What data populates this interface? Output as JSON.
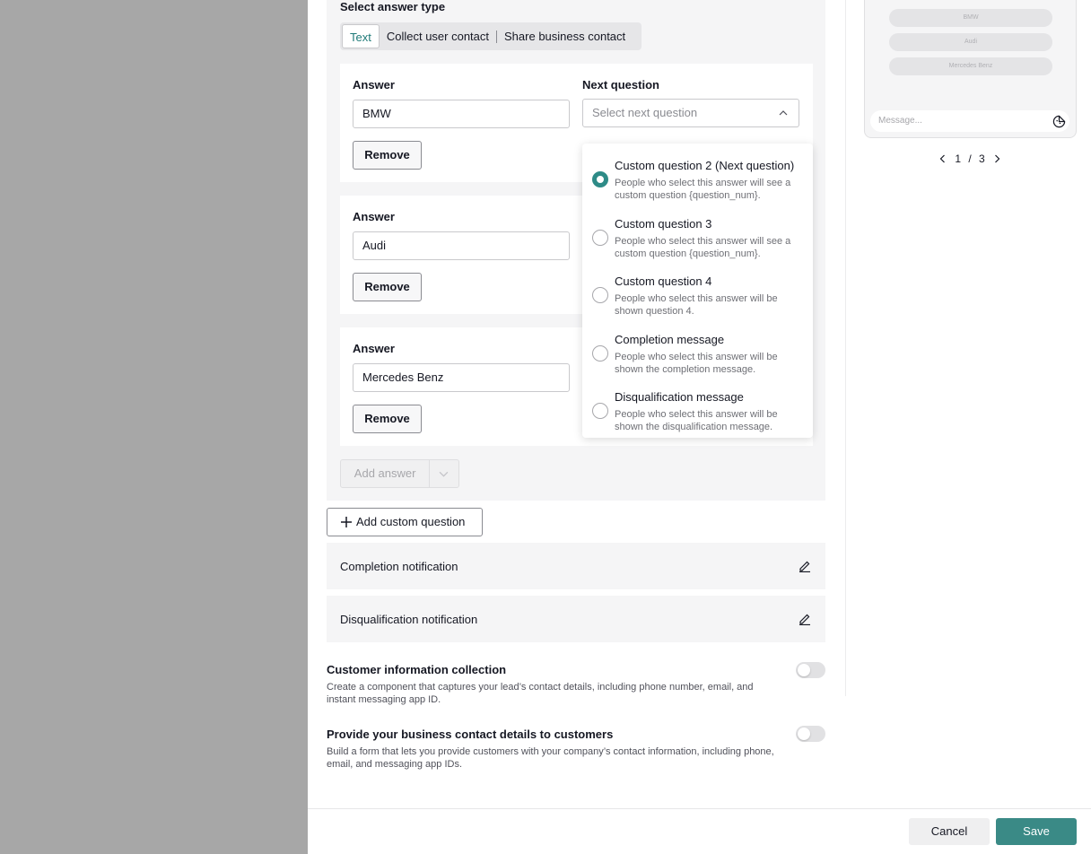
{
  "answer_type": {
    "label": "Select answer type",
    "options": [
      "Text",
      "Collect user contact",
      "Share business contact"
    ],
    "selected": "Text"
  },
  "answers": [
    {
      "label": "Answer",
      "value": "BMW",
      "remove_label": "Remove"
    },
    {
      "label": "Answer",
      "value": "Audi",
      "remove_label": "Remove"
    },
    {
      "label": "Answer",
      "value": "Mercedes Benz",
      "remove_label": "Remove"
    }
  ],
  "next_question": {
    "label": "Next question",
    "placeholder": "Select next question",
    "options": [
      {
        "title": "Custom question 2 (Next question)",
        "desc": "People who select this answer will see a custom question {question_num}.",
        "checked": true
      },
      {
        "title": "Custom question 3",
        "desc": "People who select this answer will see a custom question {question_num}.",
        "checked": false
      },
      {
        "title": "Custom question 4",
        "desc": "People who select this answer will be shown question 4.",
        "checked": false
      },
      {
        "title": "Completion message",
        "desc": "People who select this answer will be shown the completion message.",
        "checked": false
      },
      {
        "title": "Disqualification message",
        "desc": "People who select this answer will be shown the disqualification message.",
        "checked": false
      }
    ]
  },
  "add_answer_label": "Add answer",
  "add_custom_question_label": "Add custom question",
  "notifications": [
    {
      "title": "Completion notification"
    },
    {
      "title": "Disqualification notification"
    }
  ],
  "sections": [
    {
      "title": "Customer information collection",
      "desc": "Create a component that captures your lead’s contact details, including phone number, email, and instant messaging app ID.",
      "enabled": false
    },
    {
      "title": "Provide your business contact details to customers",
      "desc": "Build a form that lets you provide customers with your company’s contact information, including phone, email, and messaging app IDs.",
      "enabled": false
    }
  ],
  "preview": {
    "chips": [
      "BMW",
      "Audi",
      "Mercedes Benz"
    ],
    "message_placeholder": "Message...",
    "pager": {
      "current": "1",
      "sep": "/",
      "total": "3"
    }
  },
  "footer": {
    "cancel": "Cancel",
    "save": "Save"
  },
  "colors": {
    "accent": "#3a8a86",
    "overlay": "#a7a7a7"
  }
}
